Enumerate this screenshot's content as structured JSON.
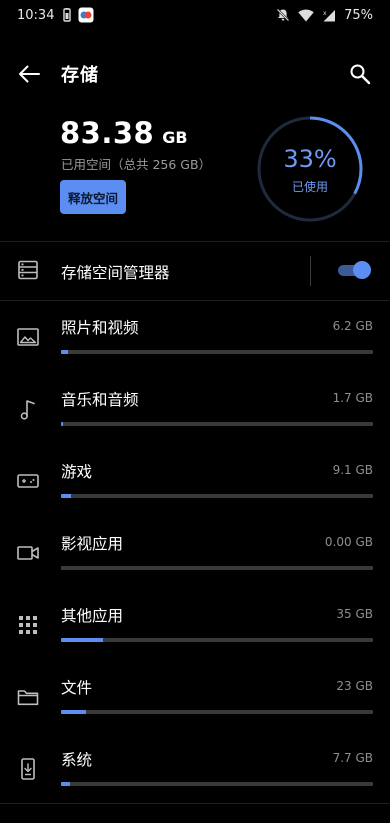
{
  "status_bar": {
    "time": "10:34",
    "battery": "75%"
  },
  "header": {
    "title": "存储"
  },
  "summary": {
    "used_number": "83.38",
    "used_unit": "GB",
    "used_desc": "已用空间（总共 256 GB）",
    "free_button": "释放空间",
    "percent_label": "33%",
    "percent_value": 33,
    "used_label": "已使用"
  },
  "manager": {
    "label": "存储空间管理器",
    "enabled": true
  },
  "categories": [
    {
      "label": "照片和视频",
      "size": "6.2 GB",
      "fill": 0.024,
      "icon": "image-icon"
    },
    {
      "label": "音乐和音频",
      "size": "1.7 GB",
      "fill": 0.007,
      "icon": "music-note-icon"
    },
    {
      "label": "游戏",
      "size": "9.1 GB",
      "fill": 0.033,
      "icon": "gamepad-icon"
    },
    {
      "label": "影视应用",
      "size": "0.00 GB",
      "fill": 0.0,
      "icon": "video-camera-icon"
    },
    {
      "label": "其他应用",
      "size": "35 GB",
      "fill": 0.135,
      "icon": "app-grid-icon"
    },
    {
      "label": "文件",
      "size": "23 GB",
      "fill": 0.08,
      "icon": "folder-icon"
    },
    {
      "label": "系统",
      "size": "7.7 GB",
      "fill": 0.028,
      "icon": "phone-download-icon"
    }
  ],
  "colors": {
    "accent": "#5b8ef0",
    "track": "#3a3a3a",
    "background": "#000000"
  }
}
